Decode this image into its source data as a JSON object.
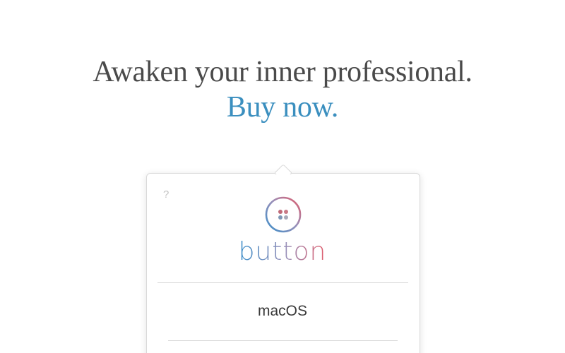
{
  "hero": {
    "headline": "Awaken your inner professional.",
    "cta": "Buy now."
  },
  "popover": {
    "help_label": "?",
    "logo_icon": "four-dot-button-icon",
    "logo_text": "button",
    "platform_label": "macOS"
  },
  "colors": {
    "headline": "#4a4a4a",
    "cta": "#3b8fbf",
    "logo_blue": "#3d8fc9",
    "logo_red": "#e15b6a"
  }
}
